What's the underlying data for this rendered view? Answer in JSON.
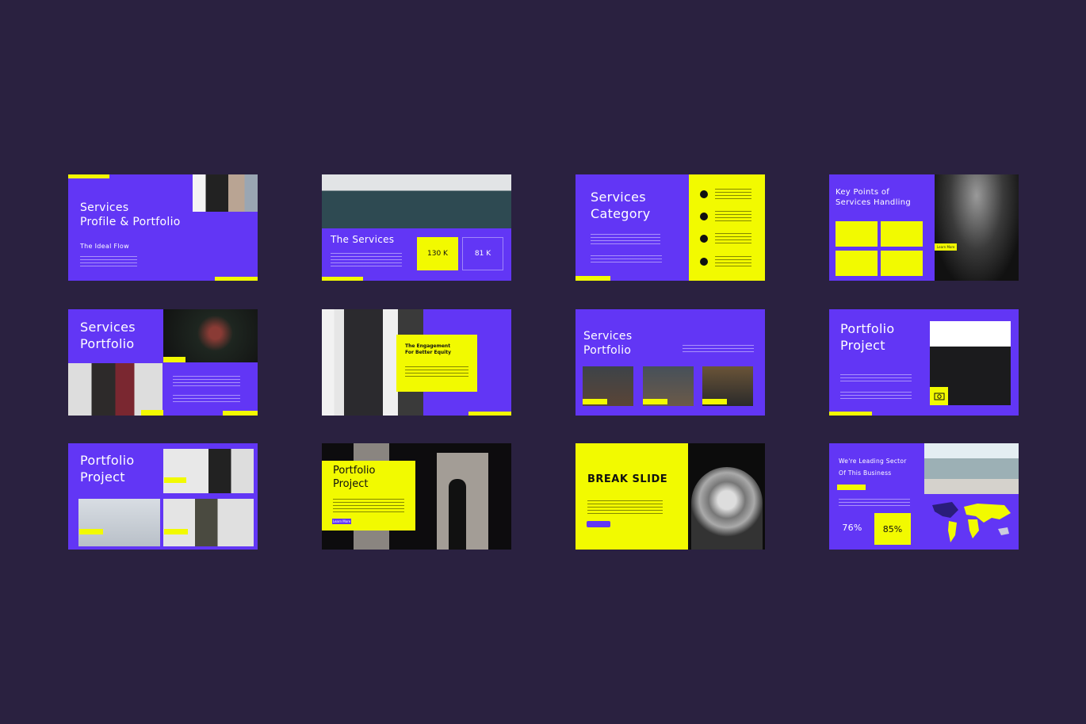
{
  "colors": {
    "background": "#2a2140",
    "purple": "#6236f5",
    "yellow": "#f2fa00"
  },
  "slides": {
    "s1": {
      "title": "Services\nProfile & Portfolio",
      "subtitle": "The Ideal Flow"
    },
    "s2": {
      "title": "The Services",
      "stat1": "130 K",
      "stat2": "81 K"
    },
    "s3": {
      "title": "Services\nCategory",
      "icons": [
        "gear-icon",
        "question-icon",
        "chart-icon",
        "bulb-icon"
      ]
    },
    "s4": {
      "title": "Key Points of\nServices Handling",
      "button": "Learn More"
    },
    "s5": {
      "title": "Services\nPortfolio"
    },
    "s6": {
      "title": "The Engagement\nFor Better Equity"
    },
    "s7": {
      "title": "Services\nPortfolio"
    },
    "s8": {
      "title": "Portfolio\nProject",
      "icon": "camera-icon"
    },
    "s9": {
      "title": "Portfolio\nProject"
    },
    "s10": {
      "title": "Portfolio\nProject",
      "button": "Learn More"
    },
    "s11": {
      "title": "BREAK SLIDE"
    },
    "s12": {
      "title": "We're Leading Sector\nOf This Business",
      "stat1": "76%",
      "stat2": "85%"
    }
  }
}
